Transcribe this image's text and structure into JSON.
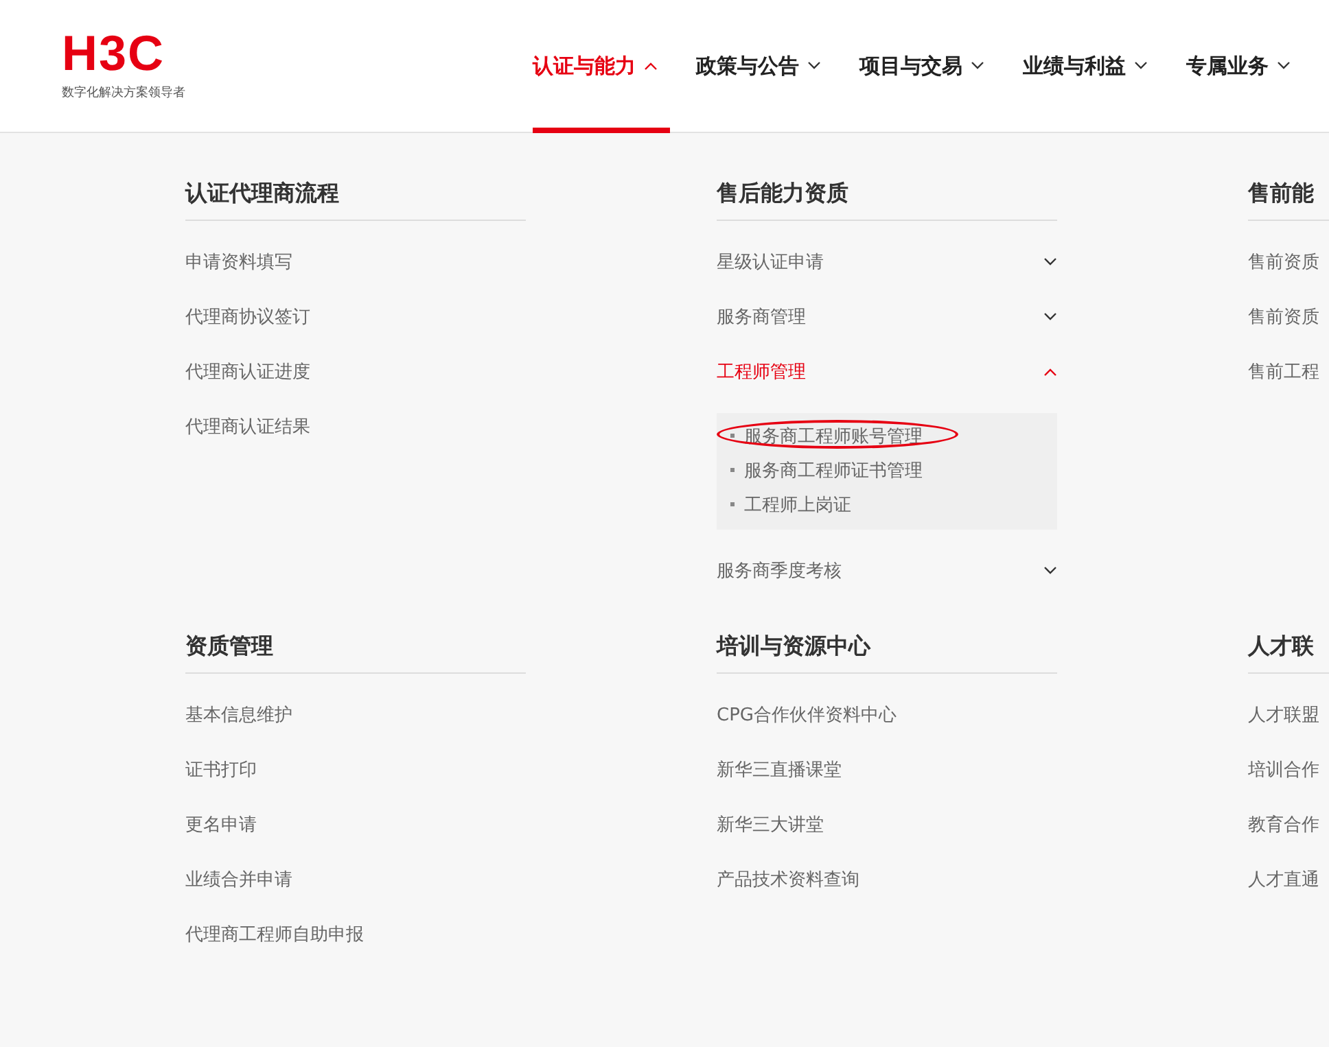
{
  "logo": {
    "brand": "H3C",
    "tagline": "数字化解决方案领导者"
  },
  "nav": [
    {
      "label": "认证与能力",
      "selected": true
    },
    {
      "label": "政策与公告",
      "selected": false
    },
    {
      "label": "项目与交易",
      "selected": false
    },
    {
      "label": "业绩与利益",
      "selected": false
    },
    {
      "label": "专属业务",
      "selected": false
    }
  ],
  "sections": [
    {
      "title": "认证代理商流程",
      "items": [
        {
          "label": "申请资料填写"
        },
        {
          "label": "代理商协议签订"
        },
        {
          "label": "代理商认证进度"
        },
        {
          "label": "代理商认证结果"
        }
      ]
    },
    {
      "title": "售后能力资质",
      "items": [
        {
          "label": "星级认证申请",
          "expanded": false
        },
        {
          "label": "服务商管理",
          "expanded": false
        },
        {
          "label": "工程师管理",
          "expanded": true,
          "children": [
            {
              "label": "服务商工程师账号管理",
              "circled": true
            },
            {
              "label": "服务商工程师证书管理",
              "circled": false
            },
            {
              "label": "工程师上岗证",
              "circled": false
            }
          ]
        },
        {
          "label": "服务商季度考核",
          "expanded": false
        }
      ]
    },
    {
      "title": "售前能",
      "items": [
        {
          "label": "售前资质"
        },
        {
          "label": "售前资质"
        },
        {
          "label": "售前工程"
        }
      ]
    },
    {
      "title": "资质管理",
      "items": [
        {
          "label": "基本信息维护"
        },
        {
          "label": "证书打印"
        },
        {
          "label": "更名申请"
        },
        {
          "label": "业绩合并申请"
        },
        {
          "label": "代理商工程师自助申报"
        }
      ]
    },
    {
      "title": "培训与资源中心",
      "items": [
        {
          "label": "CPG合作伙伴资料中心"
        },
        {
          "label": "新华三直播课堂"
        },
        {
          "label": "新华三大讲堂"
        },
        {
          "label": "产品技术资料查询"
        }
      ]
    },
    {
      "title": "人才联",
      "items": [
        {
          "label": "人才联盟"
        },
        {
          "label": "培训合作"
        },
        {
          "label": "教育合作"
        },
        {
          "label": "人才直通"
        }
      ]
    }
  ]
}
